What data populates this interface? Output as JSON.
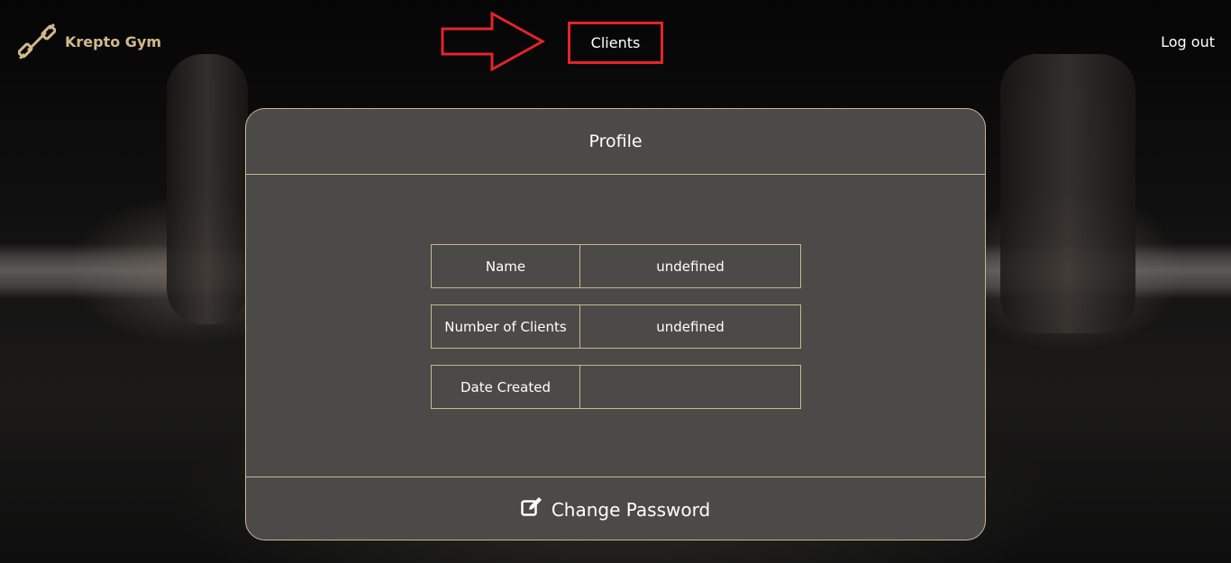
{
  "brand": {
    "name": "Krepto Gym",
    "icon": "dumbbell-icon"
  },
  "nav": {
    "clients_label": "Clients",
    "logout_label": "Log out"
  },
  "profile": {
    "title": "Profile",
    "fields": [
      {
        "label": "Name",
        "value": "undefined"
      },
      {
        "label": "Number of Clients",
        "value": "undefined"
      },
      {
        "label": "Date Created",
        "value": ""
      }
    ],
    "change_password_label": "Change Password",
    "change_password_icon": "edit-icon"
  },
  "colors": {
    "accent_gold": "#cbb58a",
    "card_bg": "#4b4a49",
    "highlight_red": "#e5232a"
  }
}
